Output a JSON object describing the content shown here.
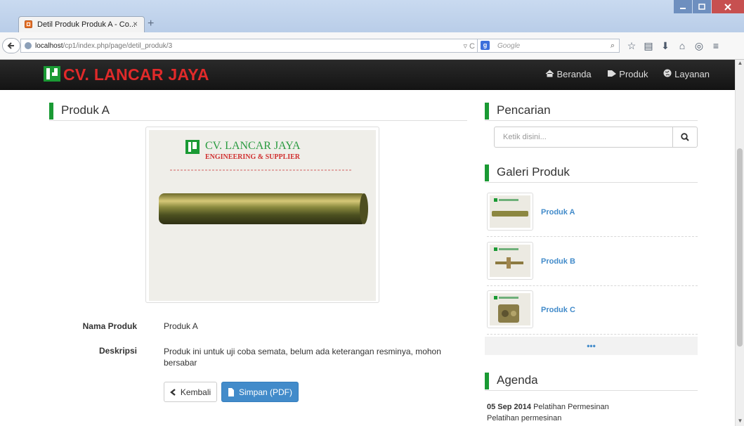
{
  "browser": {
    "tab_title": "Detil Produk Produk A - Co...",
    "tab_close": "×",
    "new_tab": "+",
    "url_host": "localhost",
    "url_path": "/cp1/index.php/page/detil_produk/3",
    "search_engine": "Google",
    "search_placeholder": "Google"
  },
  "site": {
    "brand": "CV. LANCAR JAYA",
    "nav": [
      {
        "icon": "home-icon",
        "label": "Beranda"
      },
      {
        "icon": "tag-icon",
        "label": "Produk"
      },
      {
        "icon": "globe-icon",
        "label": "Layanan"
      }
    ]
  },
  "product": {
    "heading": "Produk A",
    "image_caption": "CV. LANCAR JAYA",
    "image_subcaption": "ENGINEERING & SUPPLIER",
    "fields": [
      {
        "label": "Nama Produk",
        "value": "Produk A"
      },
      {
        "label": "Deskripsi",
        "value": "Produk ini untuk uji coba semata, belum ada keterangan resminya, mohon bersabar"
      }
    ],
    "back_label": "Kembali",
    "pdf_label": "Simpan (PDF)"
  },
  "sidebar": {
    "search_heading": "Pencarian",
    "search_placeholder": "Ketik disini...",
    "gallery_heading": "Galeri Produk",
    "gallery": [
      {
        "name": "Produk A"
      },
      {
        "name": "Produk B"
      },
      {
        "name": "Produk C"
      }
    ],
    "more_label": "•••",
    "agenda_heading": "Agenda",
    "agenda": {
      "date": "05 Sep 2014",
      "title": "Pelatihan Permesinan",
      "desc": "Pelatihan permesinan"
    }
  },
  "colors": {
    "accent_green": "#1a9a34",
    "brand_red": "#e02a2a",
    "link_blue": "#428bca"
  }
}
